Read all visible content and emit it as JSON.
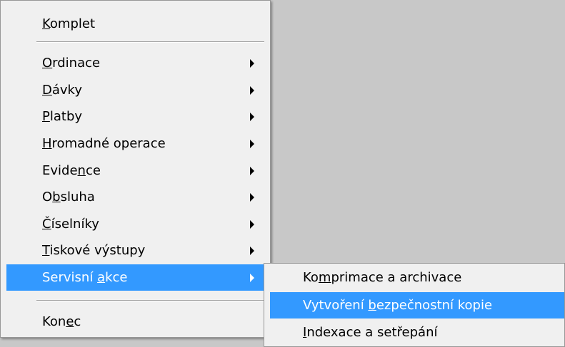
{
  "main_menu": {
    "items": [
      {
        "before": "",
        "accel": "K",
        "after": "omplet"
      },
      {
        "before": "",
        "accel": "O",
        "after": "rdinace"
      },
      {
        "before": "",
        "accel": "D",
        "after": "ávky"
      },
      {
        "before": "",
        "accel": "P",
        "after": "latby"
      },
      {
        "before": "",
        "accel": "H",
        "after": "romadné operace"
      },
      {
        "before": "Evide",
        "accel": "n",
        "after": "ce"
      },
      {
        "before": "O",
        "accel": "b",
        "after": "sluha"
      },
      {
        "before": "",
        "accel": "Č",
        "after": "íselníky"
      },
      {
        "before": "",
        "accel": "T",
        "after": "iskové výstupy"
      },
      {
        "before": "Servisní ",
        "accel": "a",
        "after": "kce"
      },
      {
        "before": "Kon",
        "accel": "e",
        "after": "c"
      }
    ]
  },
  "sub_menu": {
    "items": [
      {
        "before": "Ko",
        "accel": "m",
        "after": "primace a archivace"
      },
      {
        "before": "Vytvoření ",
        "accel": "b",
        "after": "ezpečnostní kopie"
      },
      {
        "before": "",
        "accel": "I",
        "after": "ndexace a setřepání"
      }
    ]
  },
  "colors": {
    "highlight": "#3399ff",
    "menu_bg": "#f0f0f0",
    "desktop_bg": "#c8c8c8"
  }
}
